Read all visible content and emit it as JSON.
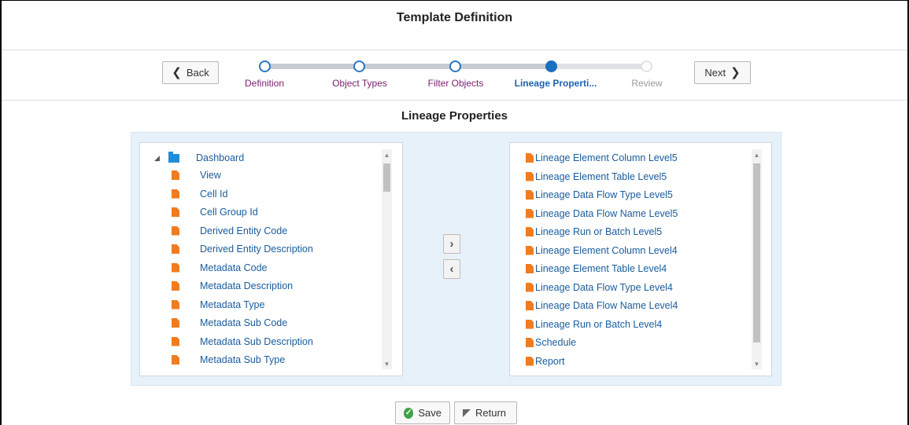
{
  "page": {
    "title": "Template Definition"
  },
  "wizard": {
    "back_label": "Back",
    "next_label": "Next",
    "steps": [
      {
        "label": "Definition",
        "state": "done"
      },
      {
        "label": "Object Types",
        "state": "done"
      },
      {
        "label": "Filter Objects",
        "state": "done"
      },
      {
        "label": "Lineage Properti...",
        "state": "active"
      },
      {
        "label": "Review",
        "state": "future"
      }
    ]
  },
  "section": {
    "title": "Lineage Properties"
  },
  "available": {
    "root": "Dashboard",
    "items": [
      "View",
      "Cell Id",
      "Cell Group Id",
      "Derived Entity Code",
      "Derived Entity Description",
      "Metadata Code",
      "Metadata Description",
      "Metadata Type",
      "Metadata Sub Code",
      "Metadata Sub Description",
      "Metadata Sub Type"
    ]
  },
  "selected": {
    "items": [
      "Lineage Element Column Level5",
      "Lineage Element Table Level5",
      "Lineage Data Flow Type Level5",
      "Lineage Data Flow Name Level5",
      "Lineage Run or Batch Level5",
      "Lineage Element Column Level4",
      "Lineage Element Table Level4",
      "Lineage Data Flow Type Level4",
      "Lineage Data Flow Name Level4",
      "Lineage Run or Batch Level4",
      "Schedule",
      "Report"
    ]
  },
  "shuttle": {
    "move_right_icon": "chevron-right-icon",
    "move_left_icon": "chevron-left-icon"
  },
  "footer": {
    "save_label": "Save",
    "return_label": "Return"
  },
  "colors": {
    "accent": "#1a6fc0",
    "file_icon": "#f07c1f",
    "folder_icon": "#1e8fd6",
    "link_text": "#1a5c9c",
    "step_done_text": "#7a1e6e"
  }
}
